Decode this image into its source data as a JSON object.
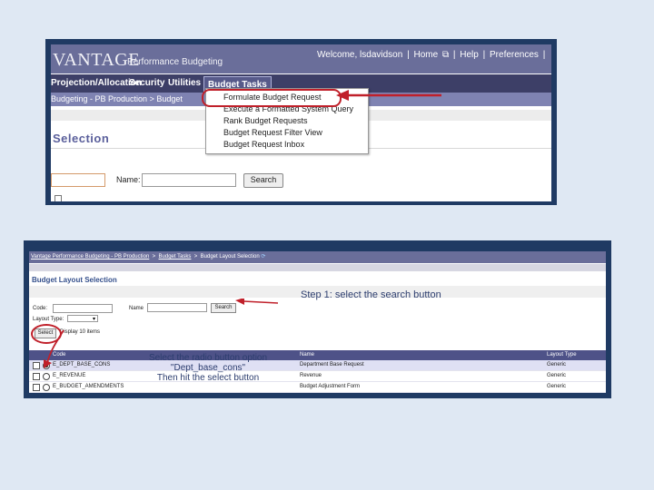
{
  "screenshot1": {
    "logo": "VANTAGE",
    "product": "Performance Budgeting",
    "header_links": [
      "Welcome, lsdavidson",
      "|",
      "Home",
      "|",
      "Help",
      "|",
      "Preferences",
      "|"
    ],
    "menu": [
      "Projection/Allocation",
      "Security",
      "Utilities",
      "Budget Tasks"
    ],
    "breadcrumb": "Budgeting - PB Production  >  Budget",
    "page_title": "Selection",
    "name_label": "Name:",
    "search_button": "Search",
    "dropdown_items": [
      "Formulate Budget Request",
      "Execute a Formatted System Query",
      "Rank Budget Requests",
      "Budget Request Filter View",
      "Budget Request Inbox"
    ]
  },
  "screenshot2": {
    "breadcrumb": {
      "part1": "Vantage Performance Budgeting - PB Production",
      "sep1": ">",
      "part2": "Budget Tasks",
      "sep2": ">",
      "part3": "Budget Layout Selection"
    },
    "page_title": "Budget Layout Selection",
    "step1": "Step 1: select the search button",
    "code_label": "Code:",
    "name_label": "Name",
    "search_button": "Search",
    "layout_type_label": "Layout Type:",
    "select_button": "Select",
    "display_text": "Display 10 items",
    "instruction": [
      "Select the radio button option",
      "\"Dept_base_cons\"",
      "Then hit the select button"
    ],
    "table": {
      "headers": [
        "Code",
        "Name",
        "Layout Type"
      ],
      "rows": [
        {
          "code": "E_DEPT_BASE_CONS",
          "name": "Department Base Request",
          "type": "Generic",
          "selected": true
        },
        {
          "code": "E_REVENUE",
          "name": "Revenue",
          "type": "Generic",
          "selected": false
        },
        {
          "code": "E_BUDGET_AMENDMENTS",
          "name": "Budget Adjustment Form",
          "type": "Generic",
          "selected": false
        }
      ]
    }
  },
  "colors": {
    "background": "#dfe8f3",
    "frame": "#1f3a63",
    "header": "#6a6e9a",
    "menubar": "#3d3f67",
    "annotation_red": "#c0202a"
  }
}
